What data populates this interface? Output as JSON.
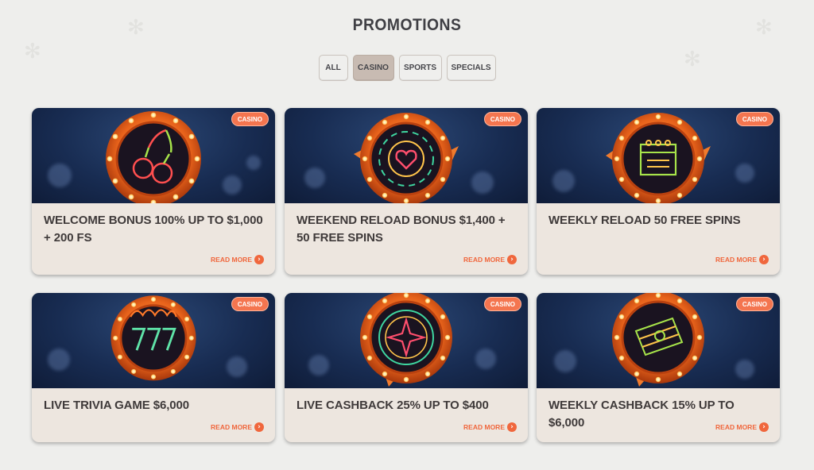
{
  "page": {
    "title": "PROMOTIONS"
  },
  "filters": [
    {
      "label": "ALL",
      "active": false
    },
    {
      "label": "CASINO",
      "active": true
    },
    {
      "label": "SPORTS",
      "active": false
    },
    {
      "label": "SPECIALS",
      "active": false
    }
  ],
  "colors": {
    "accent": "#f0673d",
    "badge": "#f4754f",
    "card_bg": "#ede6df",
    "banner_bg": "#182c52",
    "active_filter": "#c8bbb2"
  },
  "cards": [
    {
      "badge": "CASINO",
      "title": "WELCOME BONUS 100% UP TO $1,000 + 200 FS",
      "read_more": "READ MORE",
      "icon": "cherries-icon"
    },
    {
      "badge": "CASINO",
      "title": "WEEKEND RELOAD BONUS $1,400 + 50 FREE SPINS",
      "read_more": "READ MORE",
      "icon": "chip-heart-icon"
    },
    {
      "badge": "CASINO",
      "title": "WEEKLY RELOAD 50 FREE SPINS",
      "read_more": "READ MORE",
      "icon": "calendar-icon"
    },
    {
      "badge": "CASINO",
      "title": "LIVE TRIVIA GAME $6,000",
      "read_more": "READ MORE",
      "icon": "seven-seven-seven-icon"
    },
    {
      "badge": "CASINO",
      "title": "LIVE CASHBACK 25% UP TO $400",
      "read_more": "READ MORE",
      "icon": "roulette-icon"
    },
    {
      "badge": "CASINO",
      "title": "WEEKLY CASHBACK 15% UP TO $6,000",
      "read_more": "READ MORE",
      "icon": "money-stack-icon"
    }
  ]
}
